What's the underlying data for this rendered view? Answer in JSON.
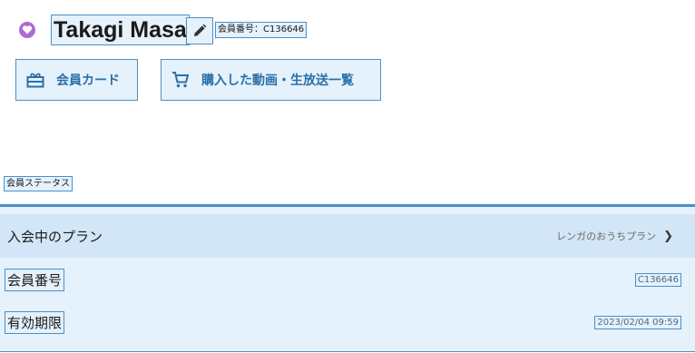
{
  "profile": {
    "name": "Takagi Masa",
    "member_no_label": "会員番号：C136646",
    "avatar_color": "#b06ad0"
  },
  "buttons": {
    "member_card": "会員カード",
    "purchased_list": "購入した動画・生放送一覧"
  },
  "status": {
    "section_label": "会員ステータス",
    "plan_label": "入会中のプラン",
    "plan_value": "レンガのおうちプラン",
    "member_no_label": "会員番号",
    "member_no_value": "C136646",
    "expiry_label": "有効期限",
    "expiry_value": "2023/02/04 09:59"
  },
  "colors": {
    "accent": "#4a90c8",
    "accent_text": "#2a6fa8",
    "panel_bg": "#e5f1fb",
    "plan_row_bg": "#d2e6f7"
  }
}
